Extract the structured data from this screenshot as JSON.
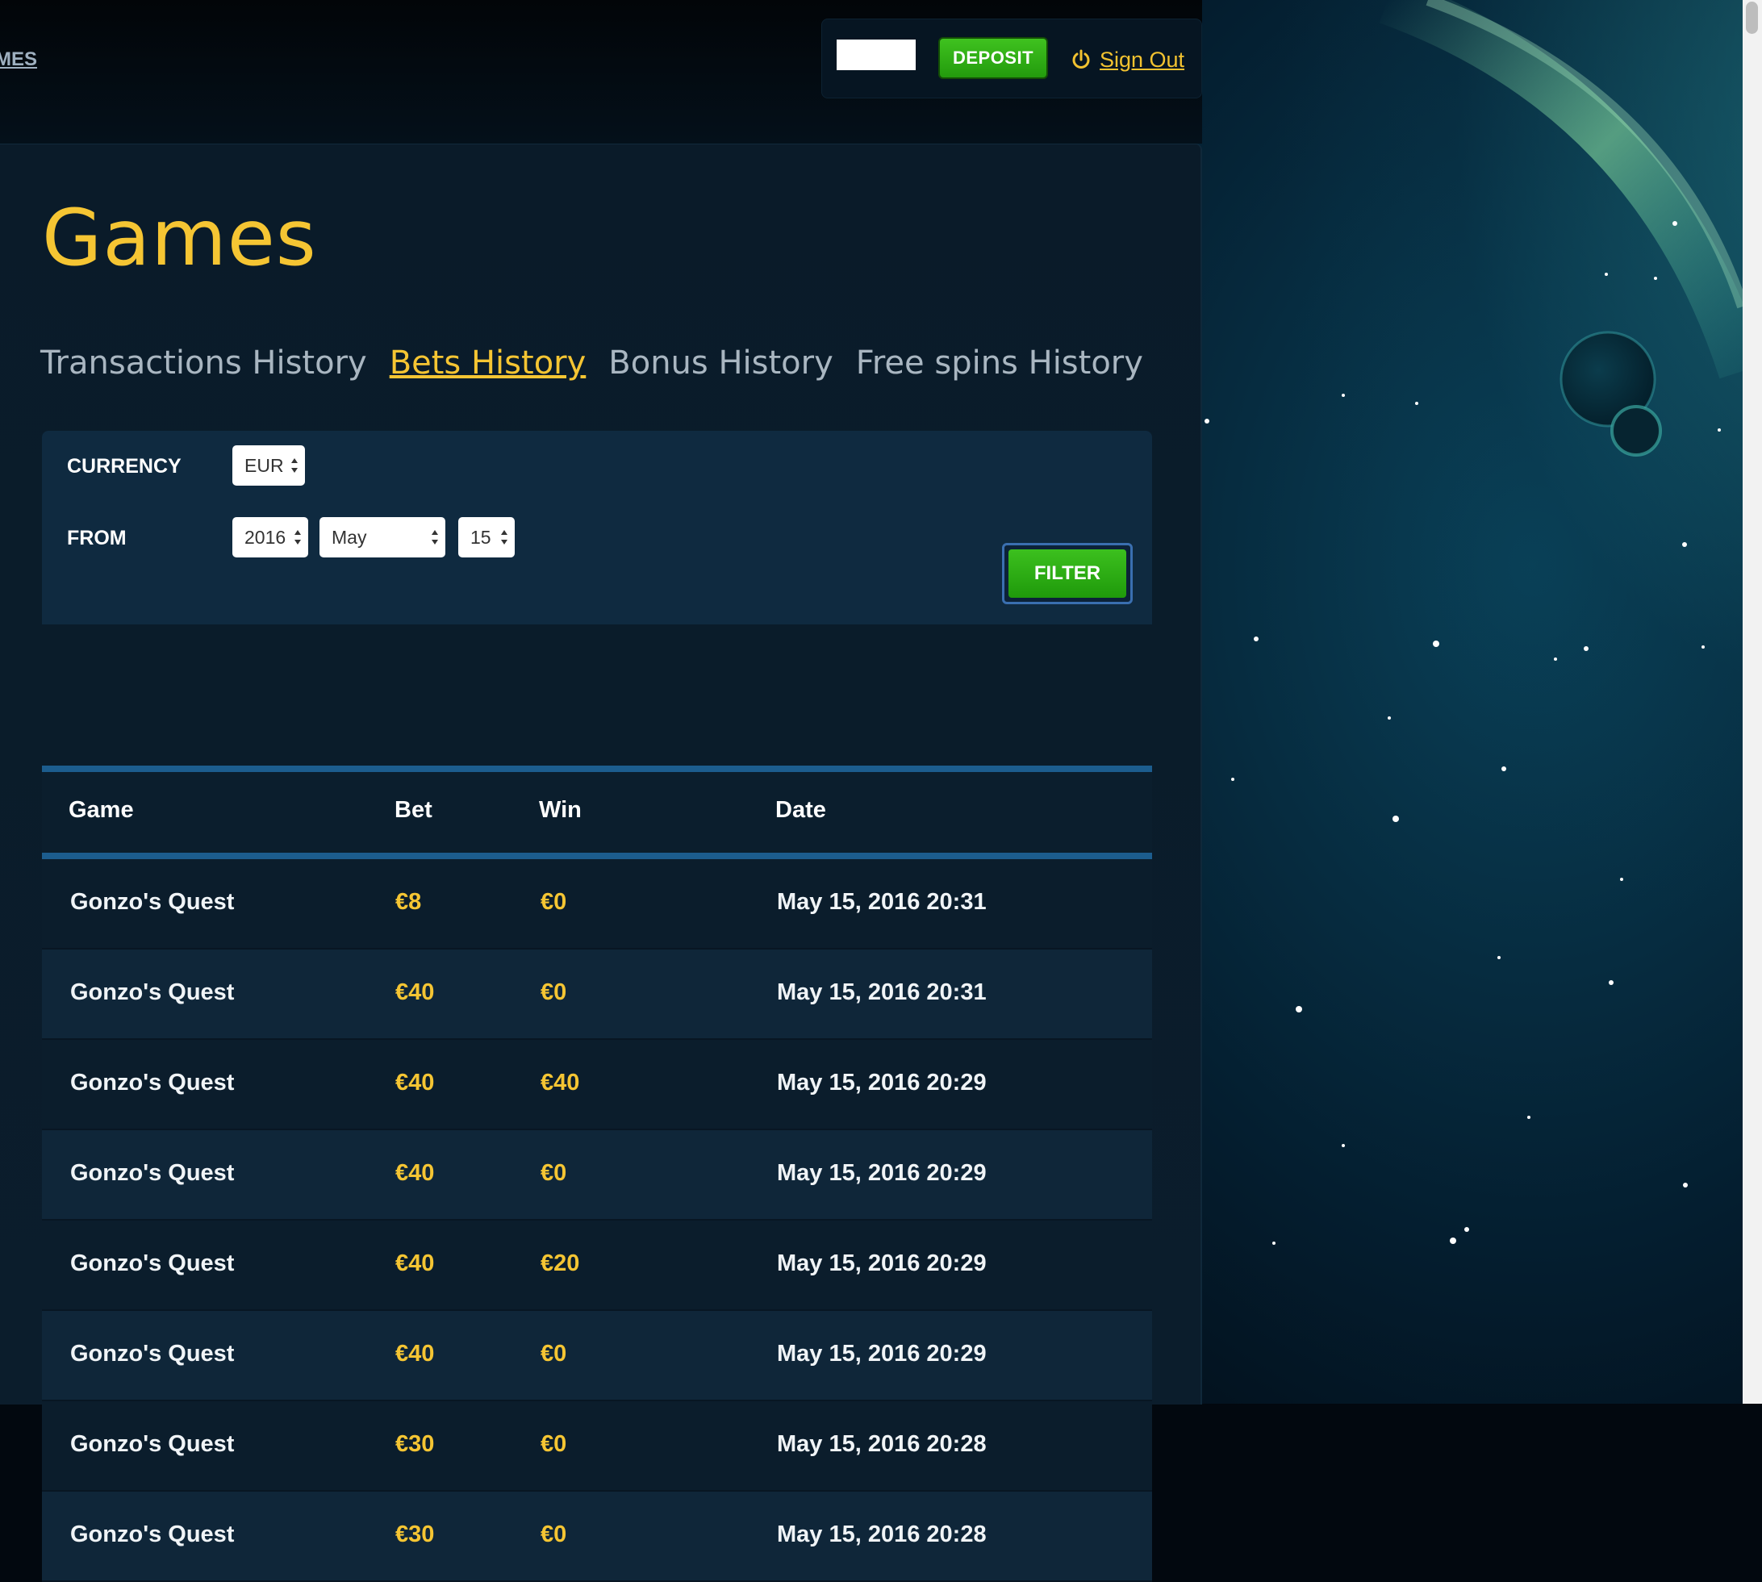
{
  "nav": {
    "left_partial": "MES"
  },
  "account": {
    "deposit_label": "DEPOSIT",
    "signout_label": "Sign Out"
  },
  "page": {
    "title": "Games",
    "tabs": [
      {
        "label": "Transactions History",
        "active": false
      },
      {
        "label": "Bets History",
        "active": true
      },
      {
        "label": "Bonus History",
        "active": false
      },
      {
        "label": "Free spins History",
        "active": false
      }
    ]
  },
  "filters": {
    "currency_label": "CURRENCY",
    "currency_value": "EUR",
    "from_label": "FROM",
    "year": "2016",
    "month": "May",
    "day": "15",
    "filter_label": "FILTER"
  },
  "table": {
    "headers": {
      "game": "Game",
      "bet": "Bet",
      "win": "Win",
      "date": "Date"
    },
    "rows": [
      {
        "game": "Gonzo's Quest",
        "bet": "€8",
        "win": "€0",
        "date": "May 15, 2016 20:31"
      },
      {
        "game": "Gonzo's Quest",
        "bet": "€40",
        "win": "€0",
        "date": "May 15, 2016 20:31"
      },
      {
        "game": "Gonzo's Quest",
        "bet": "€40",
        "win": "€40",
        "date": "May 15, 2016 20:29"
      },
      {
        "game": "Gonzo's Quest",
        "bet": "€40",
        "win": "€0",
        "date": "May 15, 2016 20:29"
      },
      {
        "game": "Gonzo's Quest",
        "bet": "€40",
        "win": "€20",
        "date": "May 15, 2016 20:29"
      },
      {
        "game": "Gonzo's Quest",
        "bet": "€40",
        "win": "€0",
        "date": "May 15, 2016 20:29"
      },
      {
        "game": "Gonzo's Quest",
        "bet": "€30",
        "win": "€0",
        "date": "May 15, 2016 20:28"
      },
      {
        "game": "Gonzo's Quest",
        "bet": "€30",
        "win": "€0",
        "date": "May 15, 2016 20:28"
      }
    ]
  },
  "colors": {
    "accent_gold": "#f5c533",
    "deposit_green": "#2fae14",
    "header_rule_blue": "#1c5d8e"
  }
}
